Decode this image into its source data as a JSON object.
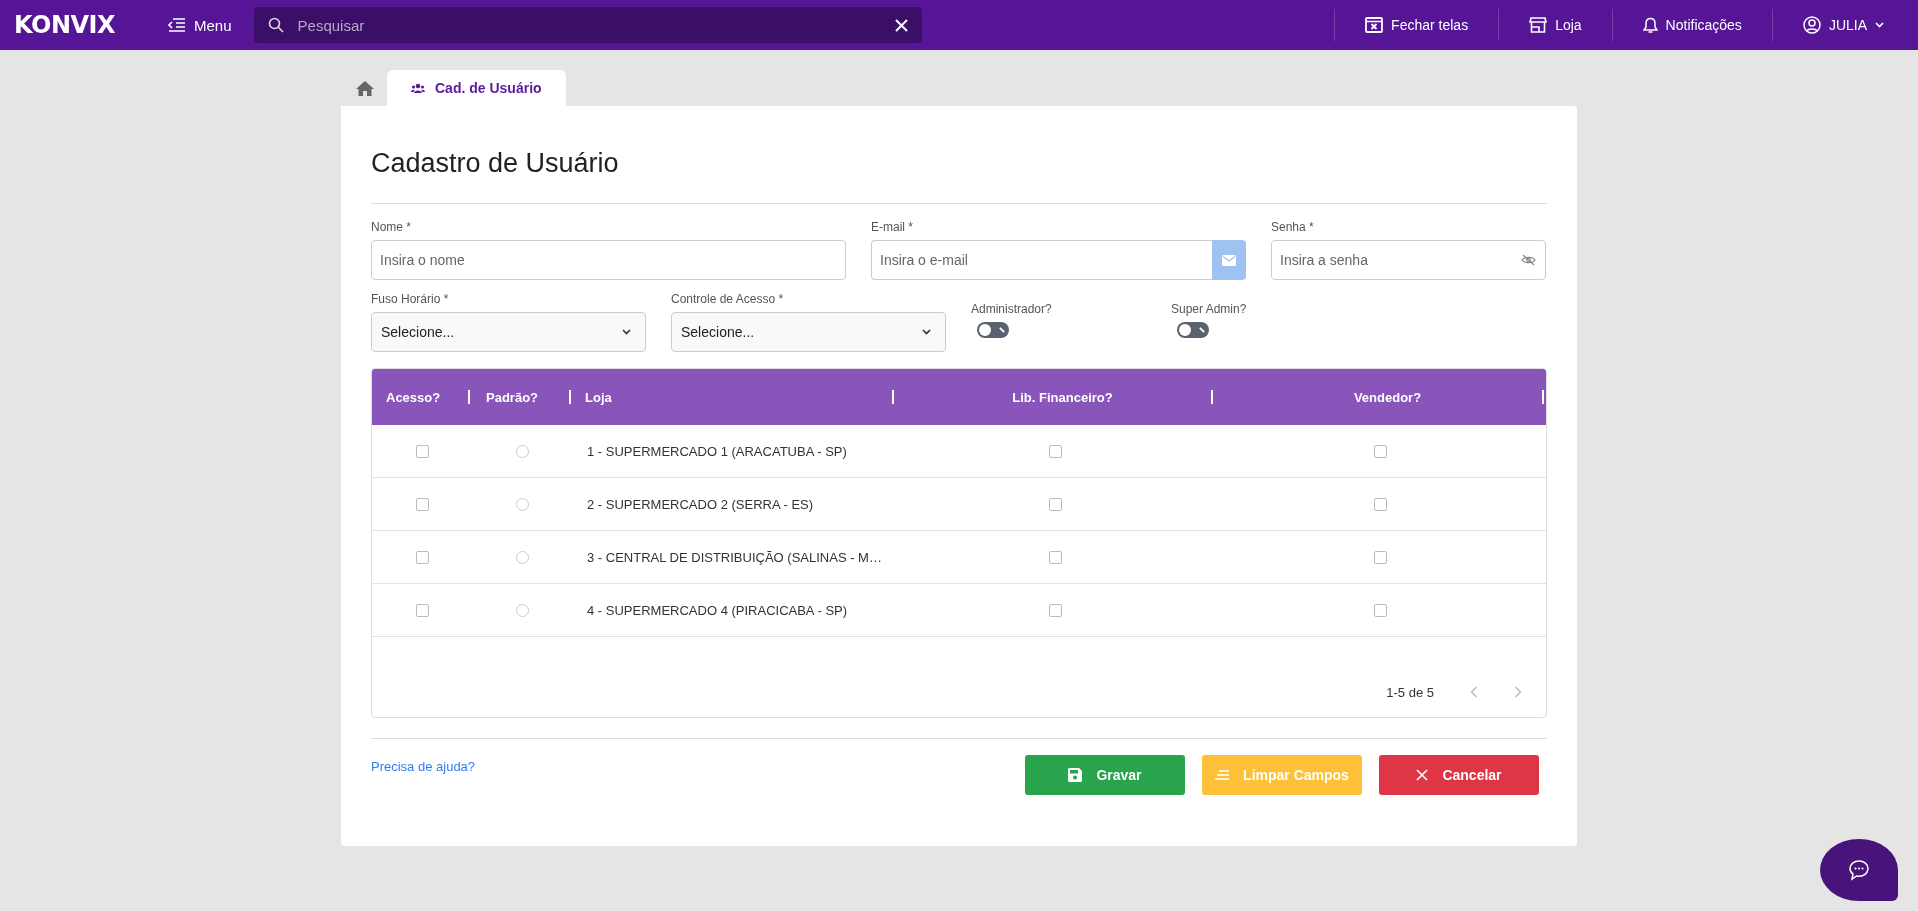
{
  "topbar": {
    "logo": "KONVIX",
    "menu": "Menu",
    "search": {
      "placeholder": "Pesquisar"
    },
    "actions": [
      {
        "kind": "close-screens",
        "label": "Fechar telas"
      },
      {
        "kind": "store",
        "label": "Loja"
      },
      {
        "kind": "bell",
        "label": "Notificações"
      },
      {
        "kind": "user",
        "label": "JULIA"
      }
    ]
  },
  "tabs": [
    {
      "kind": "home",
      "selected": false
    },
    {
      "kind": "users",
      "label": "Cad. de Usuário",
      "selected": true
    }
  ],
  "title": "Cadastro de Usuário",
  "fields": [
    {
      "label": "Nome *",
      "placeholder": "Insira o nome",
      "kind": "text"
    },
    {
      "label": "E-mail *",
      "placeholder": "Insira o e-mail",
      "kind": "email"
    },
    {
      "label": "Senha *",
      "placeholder": "Insira a senha",
      "kind": "password"
    }
  ],
  "selects": [
    {
      "label": "Fuso Horário *",
      "value": "Selecione..."
    },
    {
      "label": "Controle de Acesso *",
      "value": "Selecione..."
    }
  ],
  "toggles": [
    {
      "label": "Administrador?",
      "on": false
    },
    {
      "label": "Super Admin?",
      "on": false
    }
  ],
  "table": {
    "columns": [
      "Acesso?",
      "Padrão?",
      "Loja",
      "Lib. Financeiro?",
      "Vendedor?"
    ],
    "rows": [
      {
        "acesso": false,
        "padrao": false,
        "loja": "1 - SUPERMERCADO 1 (ARACATUBA - SP)",
        "financeiro": false,
        "vendedor": false
      },
      {
        "acesso": false,
        "padrao": false,
        "loja": "2 - SUPERMERCADO 2 (SERRA - ES)",
        "financeiro": false,
        "vendedor": false
      },
      {
        "acesso": false,
        "padrao": false,
        "loja": "3 - CENTRAL DE DISTRIBUIÇÃO (SALINAS - M…",
        "financeiro": false,
        "vendedor": false
      },
      {
        "acesso": false,
        "padrao": false,
        "loja": "4 - SUPERMERCADO 4 (PIRACICABA - SP)",
        "financeiro": false,
        "vendedor": false
      }
    ],
    "pagination": "1-5 de 5"
  },
  "help_link": "Precisa de ajuda?",
  "buttons": [
    {
      "kind": "save",
      "label": "Gravar"
    },
    {
      "kind": "clear",
      "label": "Limpar Campos"
    },
    {
      "kind": "cancel",
      "label": "Cancelar"
    }
  ]
}
